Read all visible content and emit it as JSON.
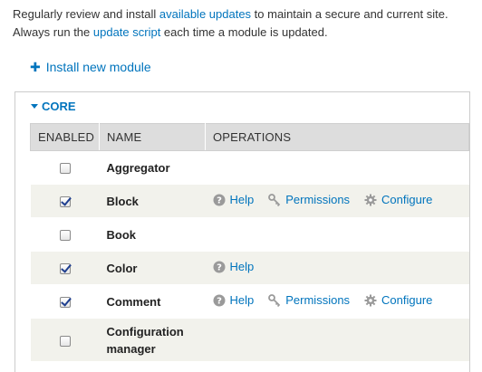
{
  "intro": {
    "line1_pre": "Regularly review and install ",
    "line1_link": "available updates",
    "line1_post": " to maintain a secure and current site.",
    "line2_pre": "Always run the ",
    "line2_link": "update script",
    "line2_post": " each time a module is updated."
  },
  "install": {
    "icon": "plus-icon",
    "label": "Install new module"
  },
  "section": {
    "legend": "CORE",
    "columns": {
      "enabled": "ENABLED",
      "name": "NAME",
      "operations": "OPERATIONS"
    }
  },
  "ops_labels": {
    "help": "Help",
    "permissions": "Permissions",
    "configure": "Configure"
  },
  "modules": [
    {
      "name": "Aggregator",
      "enabled": false,
      "ops": []
    },
    {
      "name": "Block",
      "enabled": true,
      "ops": [
        "help",
        "permissions",
        "configure"
      ]
    },
    {
      "name": "Book",
      "enabled": false,
      "ops": []
    },
    {
      "name": "Color",
      "enabled": true,
      "ops": [
        "help"
      ]
    },
    {
      "name": "Comment",
      "enabled": true,
      "ops": [
        "help",
        "permissions",
        "configure"
      ]
    },
    {
      "name": "Configuration manager",
      "enabled": false,
      "ops": []
    }
  ],
  "colors": {
    "link": "#0074bd",
    "header_bg": "#dddddd",
    "row_alt_bg": "#f2f2ec",
    "checkmark": "#1f3f8f"
  }
}
